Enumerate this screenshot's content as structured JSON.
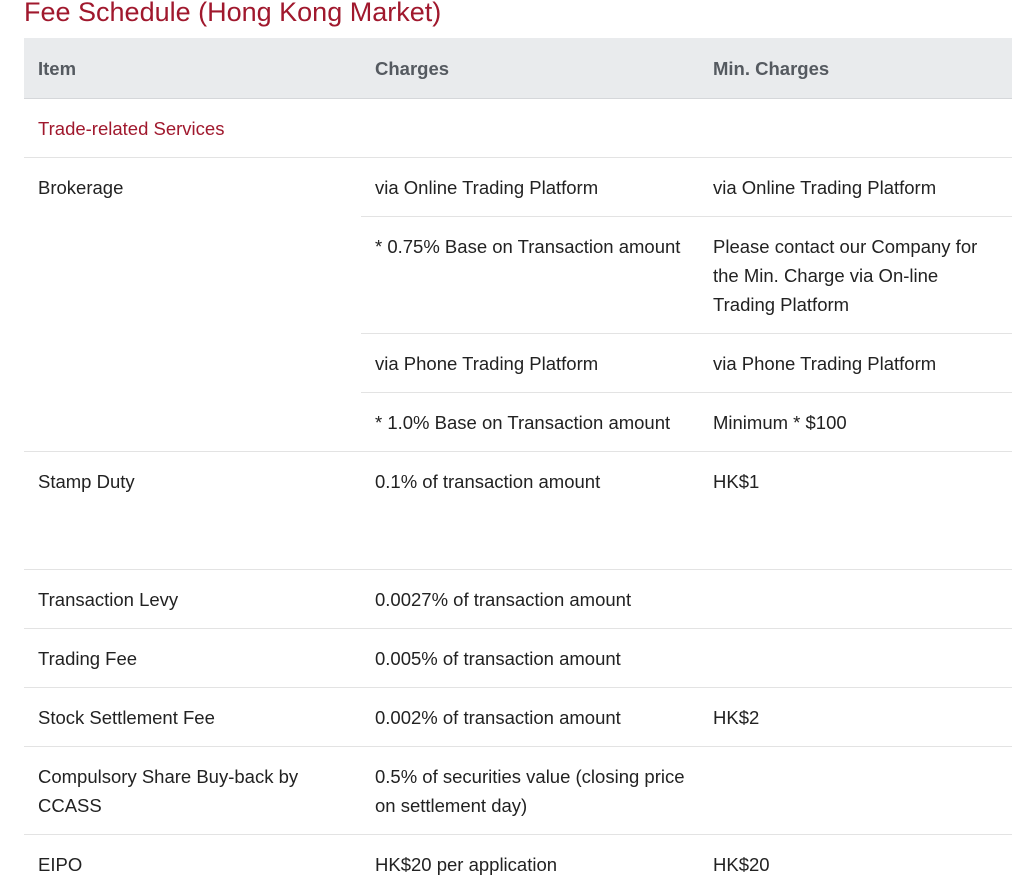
{
  "page": {
    "title": "Fee Schedule (Hong Kong Market)"
  },
  "table": {
    "headers": {
      "item": "Item",
      "charges": "Charges",
      "min_charges": "Min. Charges"
    },
    "section_trade": "Trade-related Services",
    "brokerage": {
      "item": "Brokerage",
      "online_label_charges": "via Online Trading Platform",
      "online_label_min": "via Online Trading Platform",
      "online_rate": "* 0.75% Base on Transaction amount",
      "online_min": "Please contact our Company for the Min. Charge via On-line Trading Platform",
      "phone_label_charges": "via Phone Trading Platform",
      "phone_label_min": "via Phone Trading Platform",
      "phone_rate": "* 1.0% Base on Transaction amount",
      "phone_min": "Minimum * $100"
    },
    "rows": [
      {
        "item": "Stamp Duty",
        "charges": "0.1% of transaction amount",
        "min": "HK$1"
      },
      {
        "item": "Transaction Levy",
        "charges": "0.0027% of transaction amount",
        "min": ""
      },
      {
        "item": "Trading Fee",
        "charges": "0.005% of transaction amount",
        "min": ""
      },
      {
        "item": "Stock Settlement Fee",
        "charges": "0.002% of transaction amount",
        "min": "HK$2"
      },
      {
        "item": "Compulsory Share Buy-back by CCASS",
        "charges": "0.5% of securities value (closing price on settlement day)",
        "min": ""
      },
      {
        "item": "EIPO",
        "charges": "HK$20 per application",
        "min": "HK$20"
      }
    ]
  }
}
